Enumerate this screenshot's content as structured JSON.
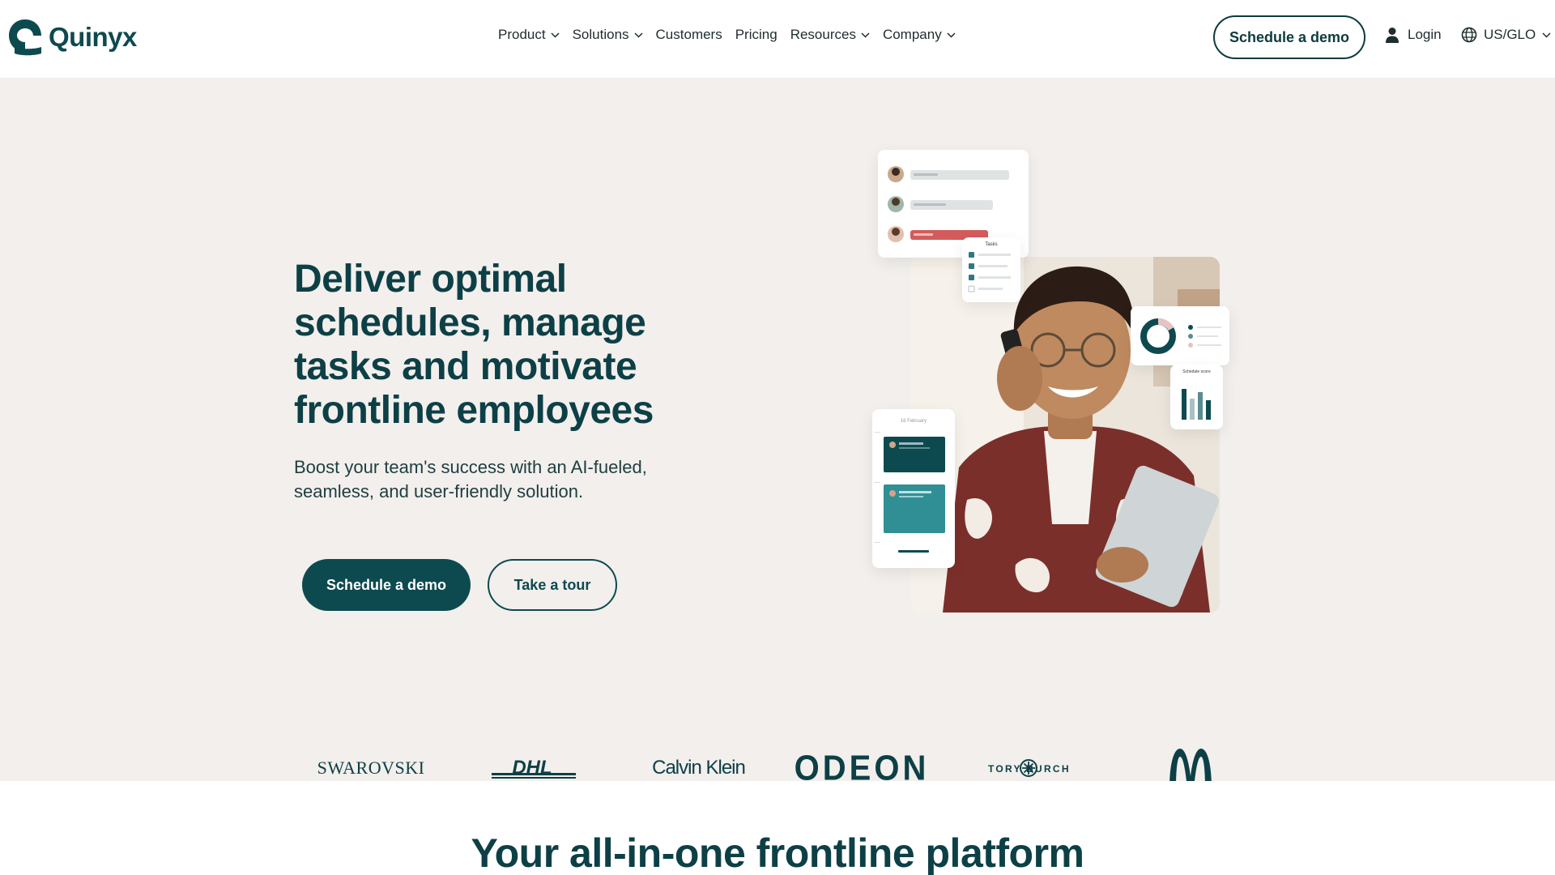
{
  "brand": {
    "name": "Quinyx"
  },
  "nav": {
    "items": [
      {
        "label": "Product",
        "has_dropdown": true
      },
      {
        "label": "Solutions",
        "has_dropdown": true
      },
      {
        "label": "Customers",
        "has_dropdown": false
      },
      {
        "label": "Pricing",
        "has_dropdown": false
      },
      {
        "label": "Resources",
        "has_dropdown": true
      },
      {
        "label": "Company",
        "has_dropdown": true
      }
    ],
    "cta": "Schedule a demo",
    "login": "Login",
    "region": "US/GLO"
  },
  "hero": {
    "title": "Deliver optimal schedules, manage tasks and motivate frontline employees",
    "subtitle": "Boost your team's success with an AI-fueled, seamless, and user-friendly solution.",
    "primary_cta": "Schedule a demo",
    "secondary_cta": "Take a tour",
    "illustration": {
      "tasks_card_title": "Tasks",
      "schedule_card_title": "Schedule score",
      "date_card_title": "16 February"
    }
  },
  "logos": [
    "SWAROVSKI",
    "DHL",
    "Calvin Klein",
    "ODEON",
    "TORY BURCH",
    "McDonald's"
  ],
  "platform": {
    "title": "Your all-in-one frontline platform"
  },
  "colors": {
    "primary": "#0d4a4f",
    "hero_bg": "#f2efec",
    "accent_red": "#d35b5b",
    "accent_teal": "#2f8f94"
  }
}
